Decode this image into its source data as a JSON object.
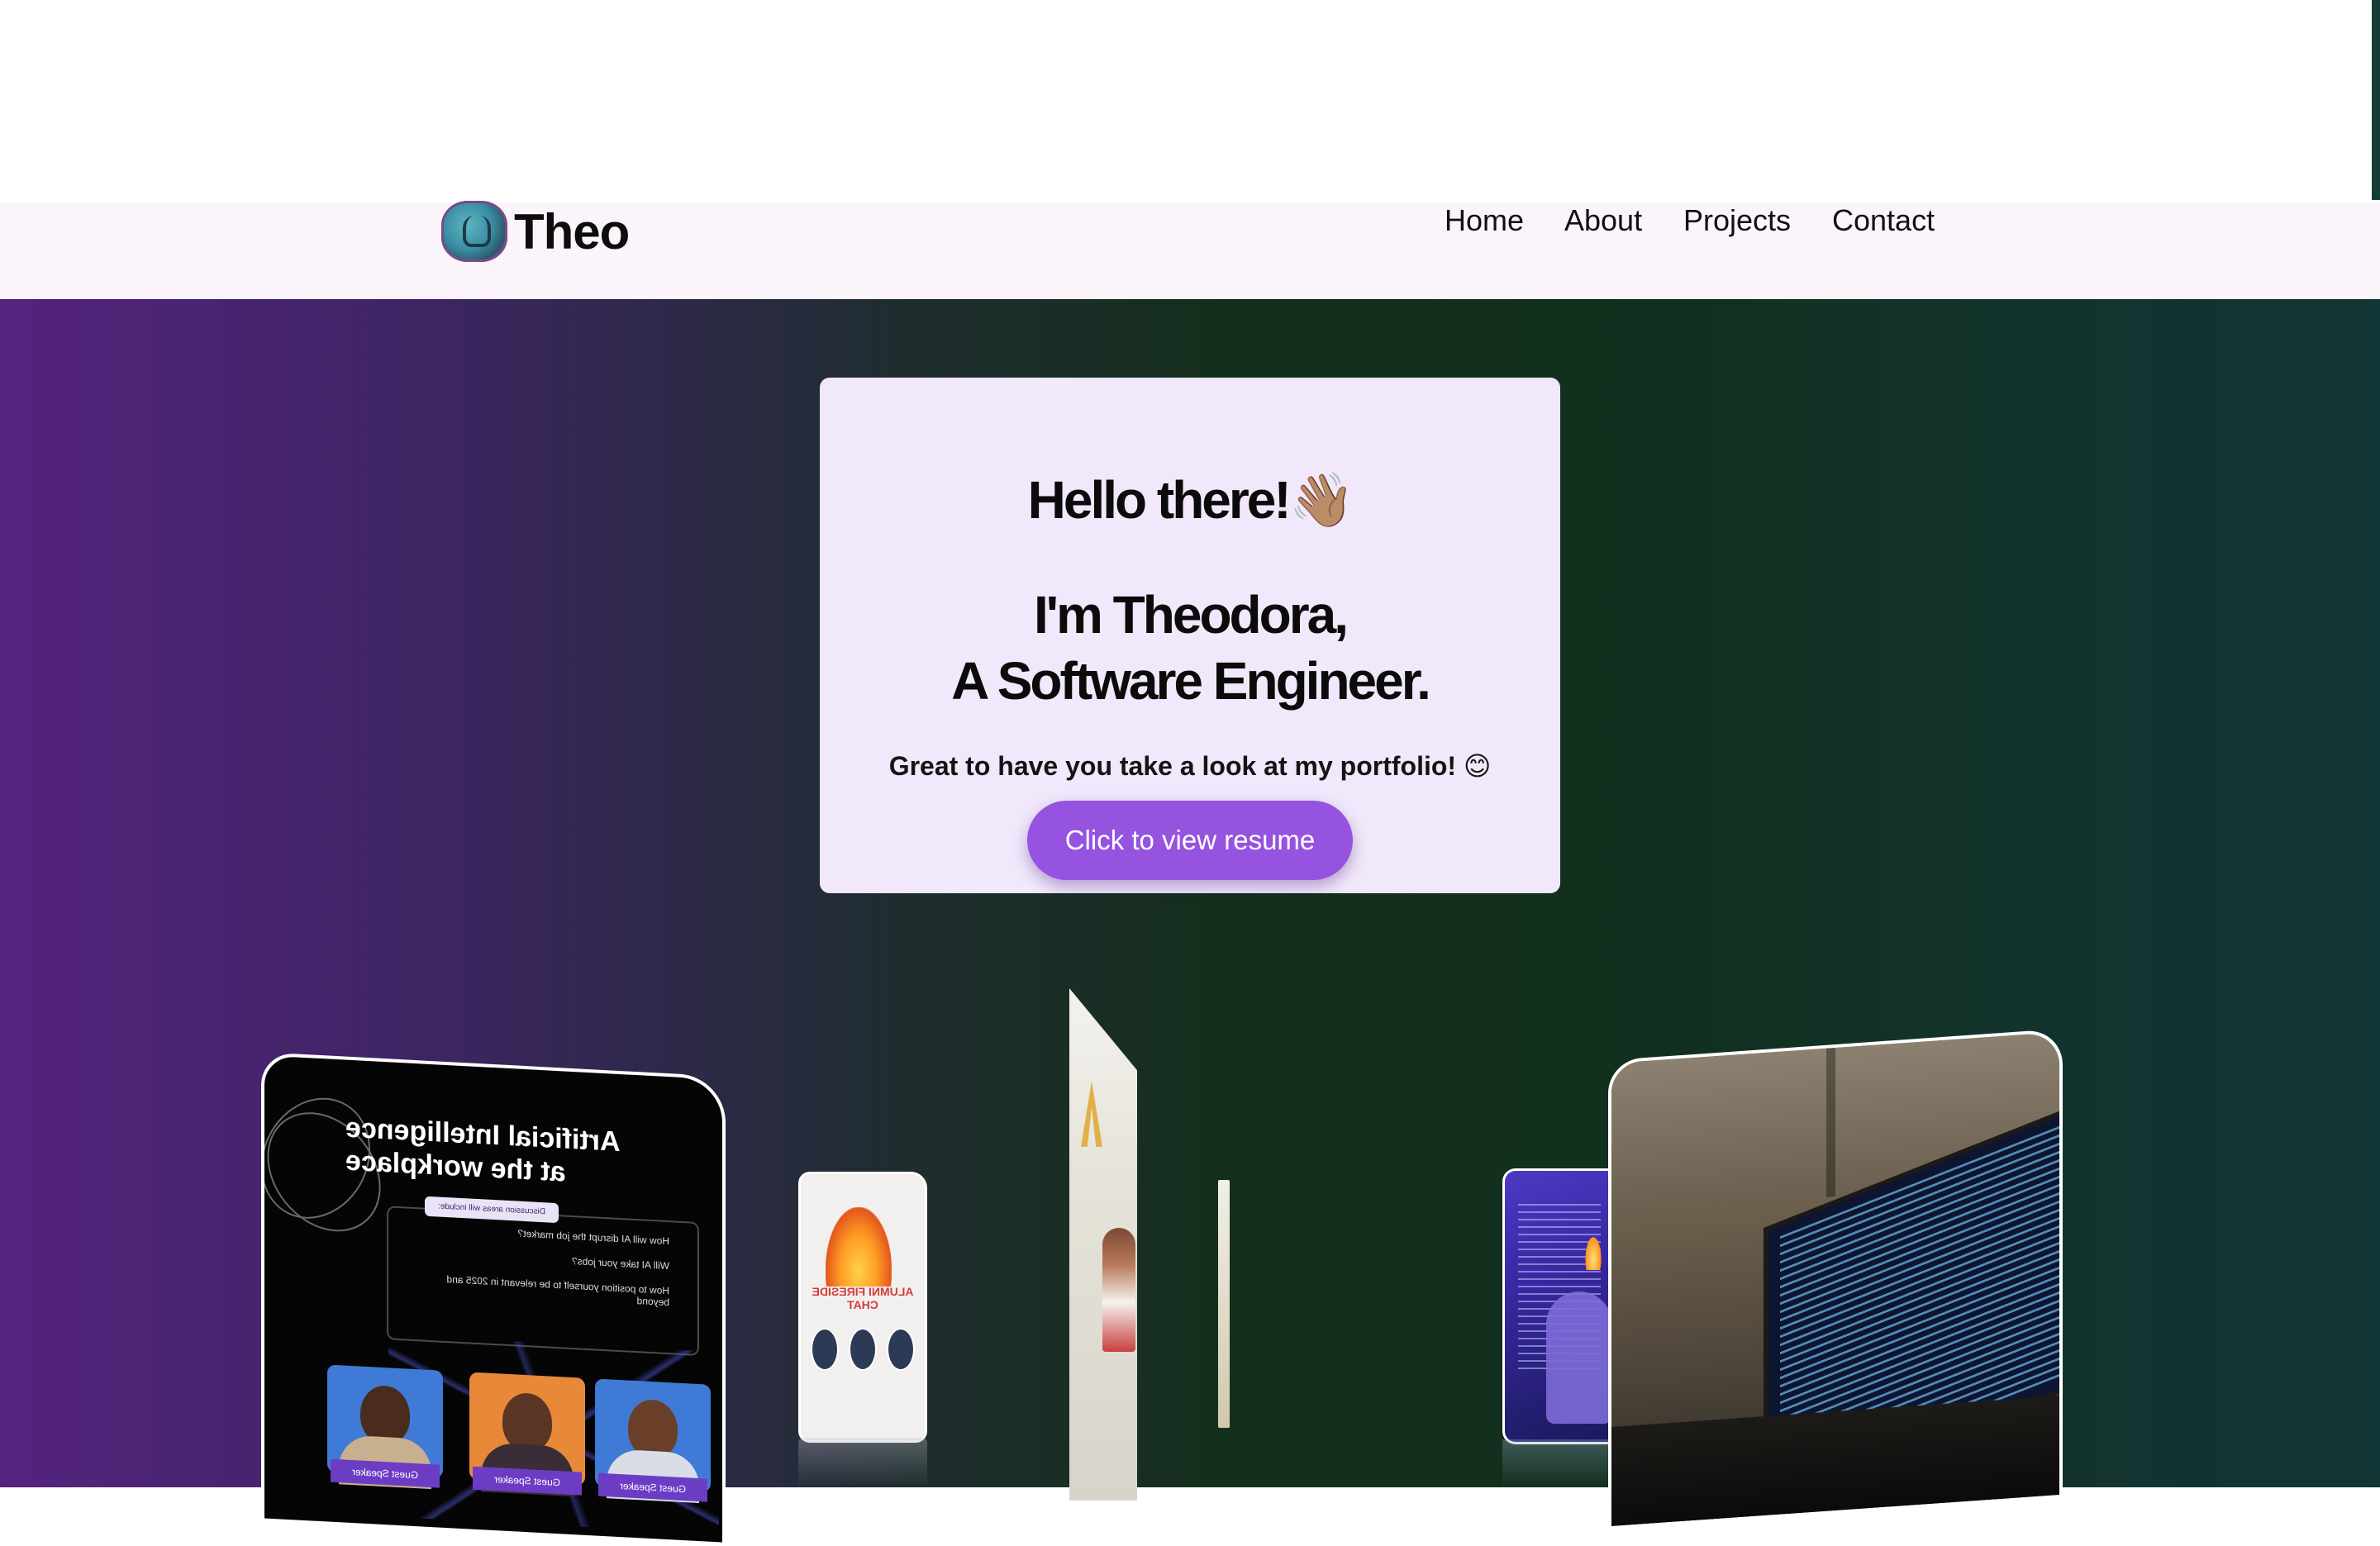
{
  "brand": {
    "name": "Theo",
    "logo_icon": "lion-logo-icon"
  },
  "nav": {
    "items": [
      {
        "label": "Home"
      },
      {
        "label": "About"
      },
      {
        "label": "Projects"
      },
      {
        "label": "Contact"
      }
    ]
  },
  "hero": {
    "greeting": "Hello there!👋🏽",
    "intro_line1": "I'm Theodora,",
    "intro_line2": "A Software Engineer.",
    "tagline": "Great to have you take a look at my portfolio! 😊",
    "resume_button": "Click to view resume"
  },
  "gallery": {
    "ai_poster": {
      "title_line1": "Artificial Intelligence",
      "title_line2": "at the workplace",
      "tag": "Discussion areas will include:",
      "bullets": [
        "How will AI disrupt the job market?",
        "Will AI take your jobs?",
        "How to position yourself to be relevant in 2025 and beyond"
      ],
      "speaker_labels": [
        "Guest Speaker",
        "Guest Speaker",
        "Guest Speaker"
      ]
    },
    "fireside_poster": {
      "title": "ALUMNI FIRESIDE CHAT"
    }
  },
  "colors": {
    "nav_background": "#fbf4fb",
    "card_background": "#f1e8fb",
    "button": "#9553e0",
    "hero_left": "#55237f",
    "hero_mid": "#142f1c",
    "hero_right": "#123535"
  }
}
